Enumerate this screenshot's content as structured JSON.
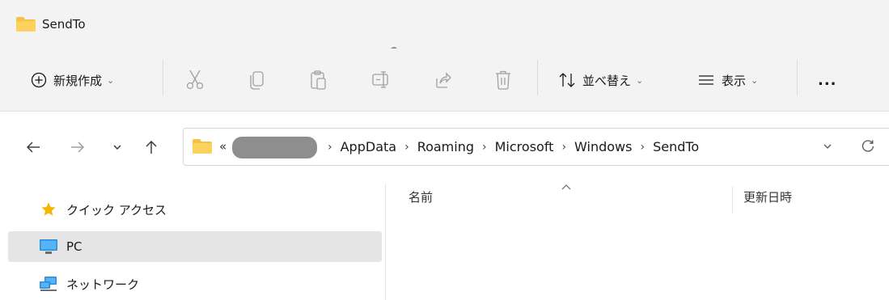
{
  "window": {
    "title": "SendTo",
    "folder_icon": "folder-icon"
  },
  "toolbar": {
    "new_label": "新規作成",
    "sort_label": "並べ替え",
    "view_label": "表示",
    "more_label": "...",
    "items": [
      {
        "name": "cut",
        "icon": "scissors-icon"
      },
      {
        "name": "copy",
        "icon": "copy-icon"
      },
      {
        "name": "paste",
        "icon": "paste-icon"
      },
      {
        "name": "rename",
        "icon": "rename-icon"
      },
      {
        "name": "share",
        "icon": "share-icon"
      },
      {
        "name": "delete",
        "icon": "trash-icon"
      }
    ]
  },
  "address": {
    "overflow": "«",
    "crumbs": [
      "AppData",
      "Roaming",
      "Microsoft",
      "Windows",
      "SendTo"
    ],
    "separator": "›"
  },
  "sidebar": {
    "items": [
      {
        "label": "クイック アクセス",
        "icon": "star-icon",
        "selected": false
      },
      {
        "label": "PC",
        "icon": "monitor-icon",
        "selected": true
      },
      {
        "label": "ネットワーク",
        "icon": "network-icon",
        "selected": false
      }
    ]
  },
  "columns": {
    "name": "名前",
    "modified": "更新日時"
  },
  "colors": {
    "chrome": "#f3f3f3",
    "selected": "#e5e5e5",
    "folder": "#f6c243",
    "star": "#f5b400",
    "monitor": "#2b8ae0"
  }
}
